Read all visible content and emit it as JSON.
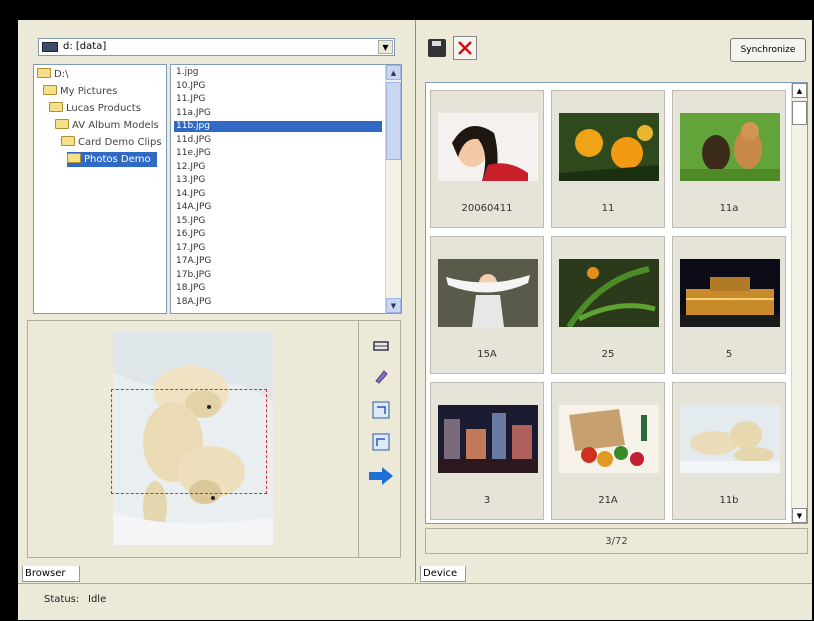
{
  "drive_selector": {
    "value": "d: [data]"
  },
  "folder_tree": [
    {
      "label": "D:\\",
      "depth": 0,
      "selected": false
    },
    {
      "label": "My Pictures",
      "depth": 1,
      "selected": false
    },
    {
      "label": "Lucas Products",
      "depth": 2,
      "selected": false
    },
    {
      "label": "AV Album Models",
      "depth": 3,
      "selected": false
    },
    {
      "label": "Card Demo Clips",
      "depth": 4,
      "selected": false
    },
    {
      "label": "Photos Demo",
      "depth": 5,
      "selected": true
    }
  ],
  "file_list": [
    "1.jpg",
    "10.JPG",
    "11.JPG",
    "11a.JPG",
    "11b.jpg",
    "11d.JPG",
    "11e.JPG",
    "12.JPG",
    "13.JPG",
    "14.JPG",
    "14A.JPG",
    "15.JPG",
    "16.JPG",
    "17.JPG",
    "17A.JPG",
    "17b.JPG",
    "18.JPG",
    "18A.JPG"
  ],
  "selected_file_index": 4,
  "thumbnails": [
    {
      "caption": "20060411",
      "scene": "portrait"
    },
    {
      "caption": "11",
      "scene": "flowers"
    },
    {
      "caption": "11a",
      "scene": "cats"
    },
    {
      "caption": "15A",
      "scene": "girl"
    },
    {
      "caption": "25",
      "scene": "plant"
    },
    {
      "caption": "5",
      "scene": "night"
    },
    {
      "caption": "3",
      "scene": "city"
    },
    {
      "caption": "21A",
      "scene": "fruit"
    },
    {
      "caption": "11b",
      "scene": "bears"
    }
  ],
  "sync_label": "Synchronize",
  "pager_text": "3/72",
  "tab_left": "Browser",
  "tab_right": "Device",
  "status": {
    "label": "Status:",
    "value": "Idle"
  },
  "colors": {
    "selection": "#316ac5",
    "window": "#ece9d8",
    "arrow": "#1f6fd6"
  }
}
